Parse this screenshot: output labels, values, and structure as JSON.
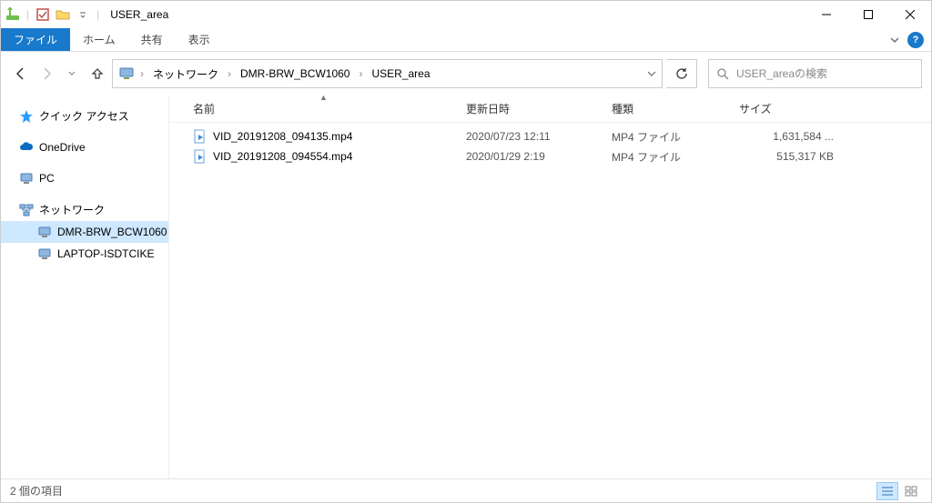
{
  "window": {
    "title": "USER_area"
  },
  "ribbon": {
    "file": "ファイル",
    "tabs": [
      "ホーム",
      "共有",
      "表示"
    ]
  },
  "breadcrumb": {
    "items": [
      "ネットワーク",
      "DMR-BRW_BCW1060",
      "USER_area"
    ]
  },
  "search": {
    "placeholder": "USER_areaの検索"
  },
  "tree": {
    "quick_access": "クイック アクセス",
    "onedrive": "OneDrive",
    "pc": "PC",
    "network": "ネットワーク",
    "network_children": [
      {
        "label": "DMR-BRW_BCW1060",
        "selected": true
      },
      {
        "label": "LAPTOP-ISDTCIKE",
        "selected": false
      }
    ]
  },
  "columns": {
    "name": "名前",
    "date": "更新日時",
    "type": "種類",
    "size": "サイズ"
  },
  "files": [
    {
      "name": "VID_20191208_094135.mp4",
      "date": "2020/07/23 12:11",
      "type": "MP4 ファイル",
      "size": "1,631,584 ..."
    },
    {
      "name": "VID_20191208_094554.mp4",
      "date": "2020/01/29 2:19",
      "type": "MP4 ファイル",
      "size": "515,317 KB"
    }
  ],
  "status": {
    "text": "2 個の項目"
  }
}
